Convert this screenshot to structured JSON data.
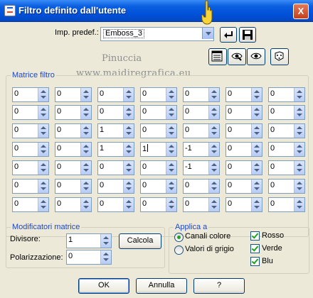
{
  "window": {
    "title": "Filtro definito dall'utente",
    "close_label": "X"
  },
  "preset": {
    "label": "Imp. predef.:",
    "value": "Emboss_3"
  },
  "watermark": {
    "line1": "Pinuccia",
    "line2": "www.maidiregrafica.eu"
  },
  "matrix": {
    "title": "Matrice filtro",
    "rows": [
      [
        "0",
        "0",
        "0",
        "0",
        "0",
        "0",
        "0"
      ],
      [
        "0",
        "0",
        "0",
        "0",
        "0",
        "0",
        "0"
      ],
      [
        "0",
        "0",
        "1",
        "0",
        "0",
        "0",
        "0"
      ],
      [
        "0",
        "0",
        "1",
        "1",
        "-1",
        "0",
        "0"
      ],
      [
        "0",
        "0",
        "0",
        "0",
        "-1",
        "0",
        "0"
      ],
      [
        "0",
        "0",
        "0",
        "0",
        "0",
        "0",
        "0"
      ],
      [
        "0",
        "0",
        "0",
        "0",
        "0",
        "0",
        "0"
      ]
    ]
  },
  "modifiers": {
    "title": "Modificatori matrice",
    "divisor_label": "Divisore:",
    "divisor_value": "1",
    "bias_label": "Polarizzazione:",
    "bias_value": "0",
    "calc_label": "Calcola"
  },
  "apply": {
    "title": "Applica a",
    "color_label": "Canali colore",
    "gray_label": "Valori di grigio",
    "selected": "Canali colore",
    "red_label": "Rosso",
    "green_label": "Verde",
    "blue_label": "Blu",
    "red_checked": true,
    "green_checked": true,
    "blue_checked": true
  },
  "buttons": {
    "ok": "OK",
    "cancel": "Annulla",
    "help": "?"
  }
}
